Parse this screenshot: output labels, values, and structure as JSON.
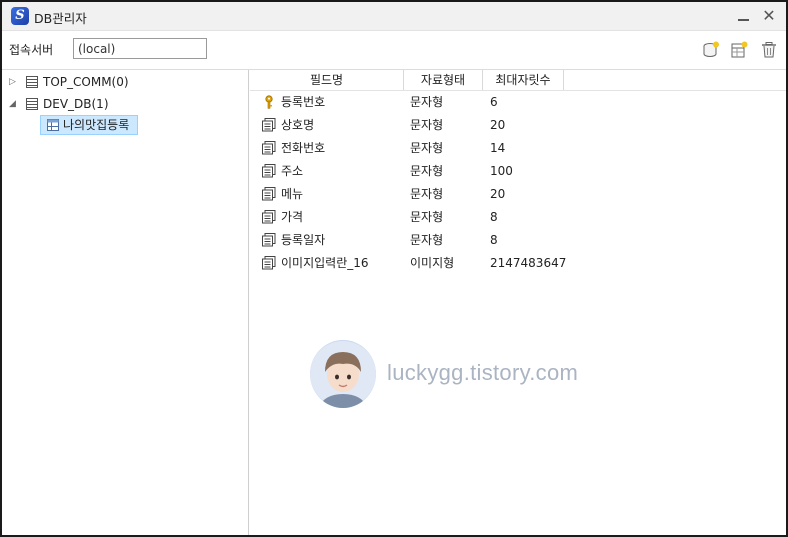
{
  "window": {
    "title": "DB관리자",
    "app_icon_letter": "S"
  },
  "toolbar": {
    "server_label": "접속서버",
    "server_value": "(local)"
  },
  "tree": {
    "nodes": [
      {
        "label": "TOP_COMM(0)",
        "expanded": false
      },
      {
        "label": "DEV_DB(1)",
        "expanded": true
      }
    ],
    "selected_child": {
      "label": "나의맛집등록"
    }
  },
  "table": {
    "headers": [
      "필드명",
      "자료형태",
      "최대자릿수"
    ],
    "rows": [
      {
        "icon": "key-icon",
        "name": "등록번호",
        "type": "문자형",
        "length": "6"
      },
      {
        "icon": "field-icon",
        "name": "상호명",
        "type": "문자형",
        "length": "20"
      },
      {
        "icon": "field-icon",
        "name": "전화번호",
        "type": "문자형",
        "length": "14"
      },
      {
        "icon": "field-icon",
        "name": "주소",
        "type": "문자형",
        "length": "100"
      },
      {
        "icon": "field-icon",
        "name": "메뉴",
        "type": "문자형",
        "length": "20"
      },
      {
        "icon": "field-icon",
        "name": "가격",
        "type": "문자형",
        "length": "8"
      },
      {
        "icon": "field-icon",
        "name": "등록일자",
        "type": "문자형",
        "length": "8"
      },
      {
        "icon": "field-icon",
        "name": "이미지입력란_16",
        "type": "이미지형",
        "length": "2147483647"
      }
    ]
  },
  "watermark": {
    "text": "luckygg.tistory.com"
  },
  "colors": {
    "selection_bg": "#cce8ff",
    "selection_border": "#99d1ff",
    "key_gold": "#e2a400"
  }
}
